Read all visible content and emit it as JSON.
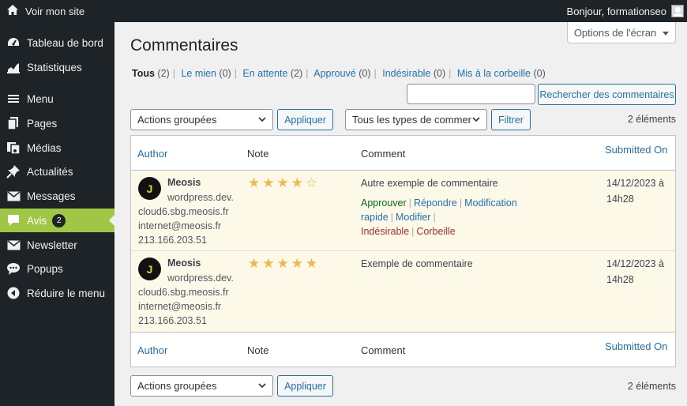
{
  "adminbar": {
    "site_label": "Voir mon site",
    "greeting": "Bonjour, formationseo",
    "site_icon": "home-icon"
  },
  "sidebar": {
    "items": [
      {
        "label": "Tableau de bord",
        "icon": "dashboard-icon"
      },
      {
        "label": "Statistiques",
        "icon": "chart-icon"
      },
      {
        "label": "Menu",
        "icon": "menu-lines-icon"
      },
      {
        "label": "Pages",
        "icon": "pages-icon"
      },
      {
        "label": "Médias",
        "icon": "media-icon"
      },
      {
        "label": "Actualités",
        "icon": "pin-icon"
      },
      {
        "label": "Messages",
        "icon": "mail-icon"
      },
      {
        "label": "Avis",
        "icon": "comment-icon",
        "badge": "2",
        "active": true
      },
      {
        "label": "Newsletter",
        "icon": "mail-icon"
      },
      {
        "label": "Popups",
        "icon": "chat-bubbles-icon"
      },
      {
        "label": "Réduire le menu",
        "icon": "collapse-icon"
      }
    ],
    "accent_color": "#a0c646"
  },
  "screen_options": {
    "label": "Options de l'écran"
  },
  "page_title": "Commentaires",
  "filters": [
    {
      "label": "Tous",
      "count": "(2)",
      "current": true
    },
    {
      "label": "Le mien",
      "count": "(0)"
    },
    {
      "label": "En attente",
      "count": "(2)"
    },
    {
      "label": "Approuvé",
      "count": "(0)"
    },
    {
      "label": "Indésirable",
      "count": "(0)"
    },
    {
      "label": "Mis à la corbeille",
      "count": "(0)"
    }
  ],
  "search": {
    "button_label": "Rechercher des commentaires",
    "value": ""
  },
  "top_nav": {
    "bulk_select": "Actions groupées",
    "apply_label": "Appliquer",
    "type_select": "Tous les types de comment",
    "filter_label": "Filtrer",
    "count": "2 éléments"
  },
  "bottom_nav": {
    "bulk_select": "Actions groupées",
    "apply_label": "Appliquer",
    "count": "2 éléments"
  },
  "table": {
    "columns": {
      "author": "Author",
      "note": "Note",
      "comment": "Comment",
      "submitted": "Submitted On"
    },
    "rows": [
      {
        "avatar_letter": "J",
        "author": "Meosis",
        "lines": [
          "wordpress.dev.",
          "cloud6.sbg.meosis.fr",
          "internet@meosis.fr",
          "213.166.203.51"
        ],
        "rating": 4,
        "comment": "Autre exemple de commentaire",
        "actions": {
          "approve": "Approuver",
          "reply": "Répondre",
          "quick_edit": "Modification rapide",
          "edit": "Modifier",
          "spam": "Indésirable",
          "trash": "Corbeille"
        },
        "date_line1": "14/12/2023 à",
        "date_line2": "14h28"
      },
      {
        "avatar_letter": "J",
        "author": "Meosis",
        "lines": [
          "wordpress.dev.",
          "cloud6.sbg.meosis.fr",
          "internet@meosis.fr",
          "213.166.203.51"
        ],
        "rating": 5,
        "comment": "Exemple de commentaire",
        "date_line1": "14/12/2023 à",
        "date_line2": "14h28"
      }
    ]
  }
}
